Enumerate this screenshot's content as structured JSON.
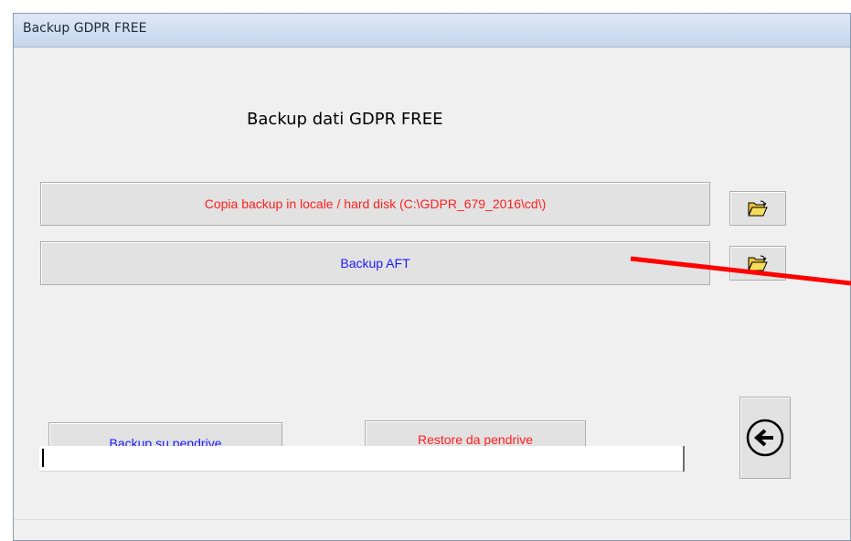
{
  "window": {
    "title": "Backup GDPR FREE"
  },
  "form": {
    "heading": "Backup dati GDPR FREE",
    "local_backup_label": "Copia backup in locale / hard disk (C:\\GDPR_679_2016\\cd\\)",
    "aft_backup_label": "Backup AFT",
    "pendrive_backup_label": "Backup su pendrive",
    "pendrive_restore_label": "Restore da pendrive",
    "progress_text": ""
  },
  "icons": {
    "folder_open": "folder-open-icon",
    "back": "back-arrow-icon"
  },
  "colors": {
    "red_text": "#ff2020",
    "blue_text": "#1a1aff",
    "annotation_arrow": "#ff0000"
  }
}
